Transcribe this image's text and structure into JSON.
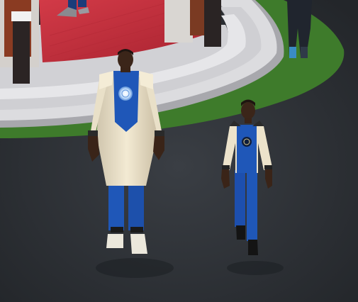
{
  "scene": {
    "description_hidden": "",
    "colors": {
      "ground": "#2b2e33",
      "ground_dark": "#24272b",
      "lawn": "#3f7a2a",
      "steps": "#d8d8dc",
      "steps_shadow": "#a9a9ae",
      "platform_floor": "#c0323f",
      "pillar": "#2a2424",
      "coat": "#efe6cf",
      "uniform_blue": "#1f57b8",
      "skin": "#3a2418",
      "boots": "#e8e4d8"
    },
    "characters": [
      {
        "role": "adult",
        "emblem_icon": "glowing-badge-icon"
      },
      {
        "role": "child",
        "emblem_icon": "badge-icon"
      }
    ]
  }
}
